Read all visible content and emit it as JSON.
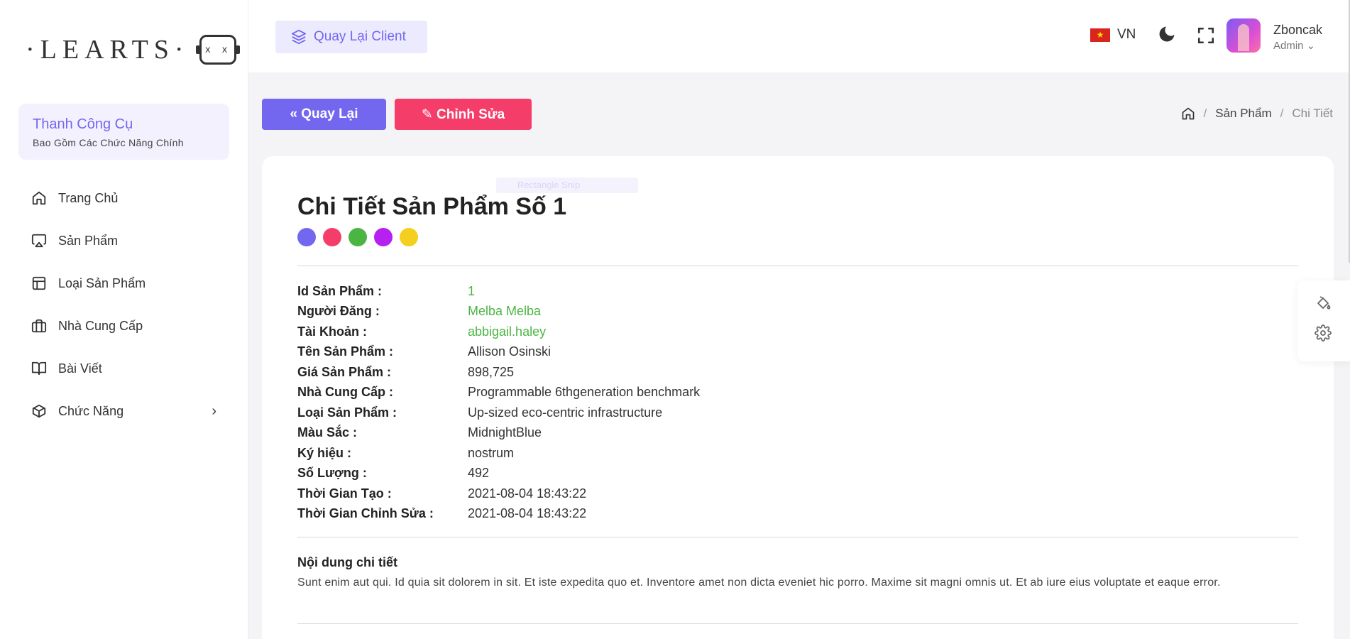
{
  "brand": {
    "logo_text": "·LEARTS·",
    "bot_face": "x x"
  },
  "sidebar": {
    "toolbox_title": "Thanh Công Cụ",
    "toolbox_subtitle": "Bao Gồm Các Chức Năng Chính",
    "items": [
      {
        "label": "Trang Chủ",
        "icon": "home-icon"
      },
      {
        "label": "Sản Phẩm",
        "icon": "airplay-icon"
      },
      {
        "label": "Loại Sản Phẩm",
        "icon": "layout-icon"
      },
      {
        "label": "Nhà Cung Cấp",
        "icon": "briefcase-icon"
      },
      {
        "label": "Bài Viết",
        "icon": "book-icon"
      },
      {
        "label": "Chức Năng",
        "icon": "box-icon",
        "chevron": "›"
      }
    ]
  },
  "header": {
    "back_client_label": "Quay Lại Client",
    "language": "VN",
    "user_name": "Zboncak",
    "user_role": "Admin ⌄"
  },
  "actions": {
    "back_label": "« Quay Lại",
    "edit_label": "✎ Chỉnh Sửa"
  },
  "breadcrumb": {
    "items": [
      "Sản Phẩm",
      "Chi Tiết"
    ],
    "separator": "/"
  },
  "detail": {
    "title": "Chi Tiết Sản Phẩm Số 1",
    "ghost_text": "Rectangle Snip",
    "color_dots": [
      "#7367f0",
      "#f53d6a",
      "#4bb543",
      "#b620f0",
      "#f5cf1d"
    ],
    "rows": [
      {
        "label": "Id Sản Phẩm    :",
        "value": "1",
        "highlight": true
      },
      {
        "label": "Người Đăng    :",
        "value": "Melba Melba",
        "highlight": true
      },
      {
        "label": "Tài Khoản    :",
        "value": "abbigail.haley",
        "highlight": true
      },
      {
        "label": "Tên Sản Phẩm    :",
        "value": "Allison Osinski"
      },
      {
        "label": "Giá Sản Phẩm    :",
        "value": "898,725"
      },
      {
        "label": "Nhà Cung Cấp    :",
        "value": "Programmable 6thgeneration benchmark"
      },
      {
        "label": "Loại Sản Phẩm    :",
        "value": "Up-sized eco-centric infrastructure"
      },
      {
        "label": "Màu Sắc    :",
        "value": "MidnightBlue"
      },
      {
        "label": "Ký hiệu    :",
        "value": "nostrum"
      },
      {
        "label": "Số Lượng    :",
        "value": "492"
      },
      {
        "label": "Thời Gian Tạo    :",
        "value": "2021-08-04 18:43:22"
      },
      {
        "label": "Thời Gian Chỉnh Sửa    :",
        "value": "2021-08-04 18:43:22"
      }
    ],
    "content_title": "Nội dung chi tiết",
    "content_body": "Sunt enim aut qui. Id quia sit dolorem in sit. Et iste expedita quo et. Inventore amet non dicta eveniet hic porro. Maxime sit magni omnis ut. Et ab iure eius voluptate et eaque error."
  },
  "colors": {
    "accent": "#7367f0",
    "danger": "#f53d6a",
    "success": "#4bb543"
  }
}
